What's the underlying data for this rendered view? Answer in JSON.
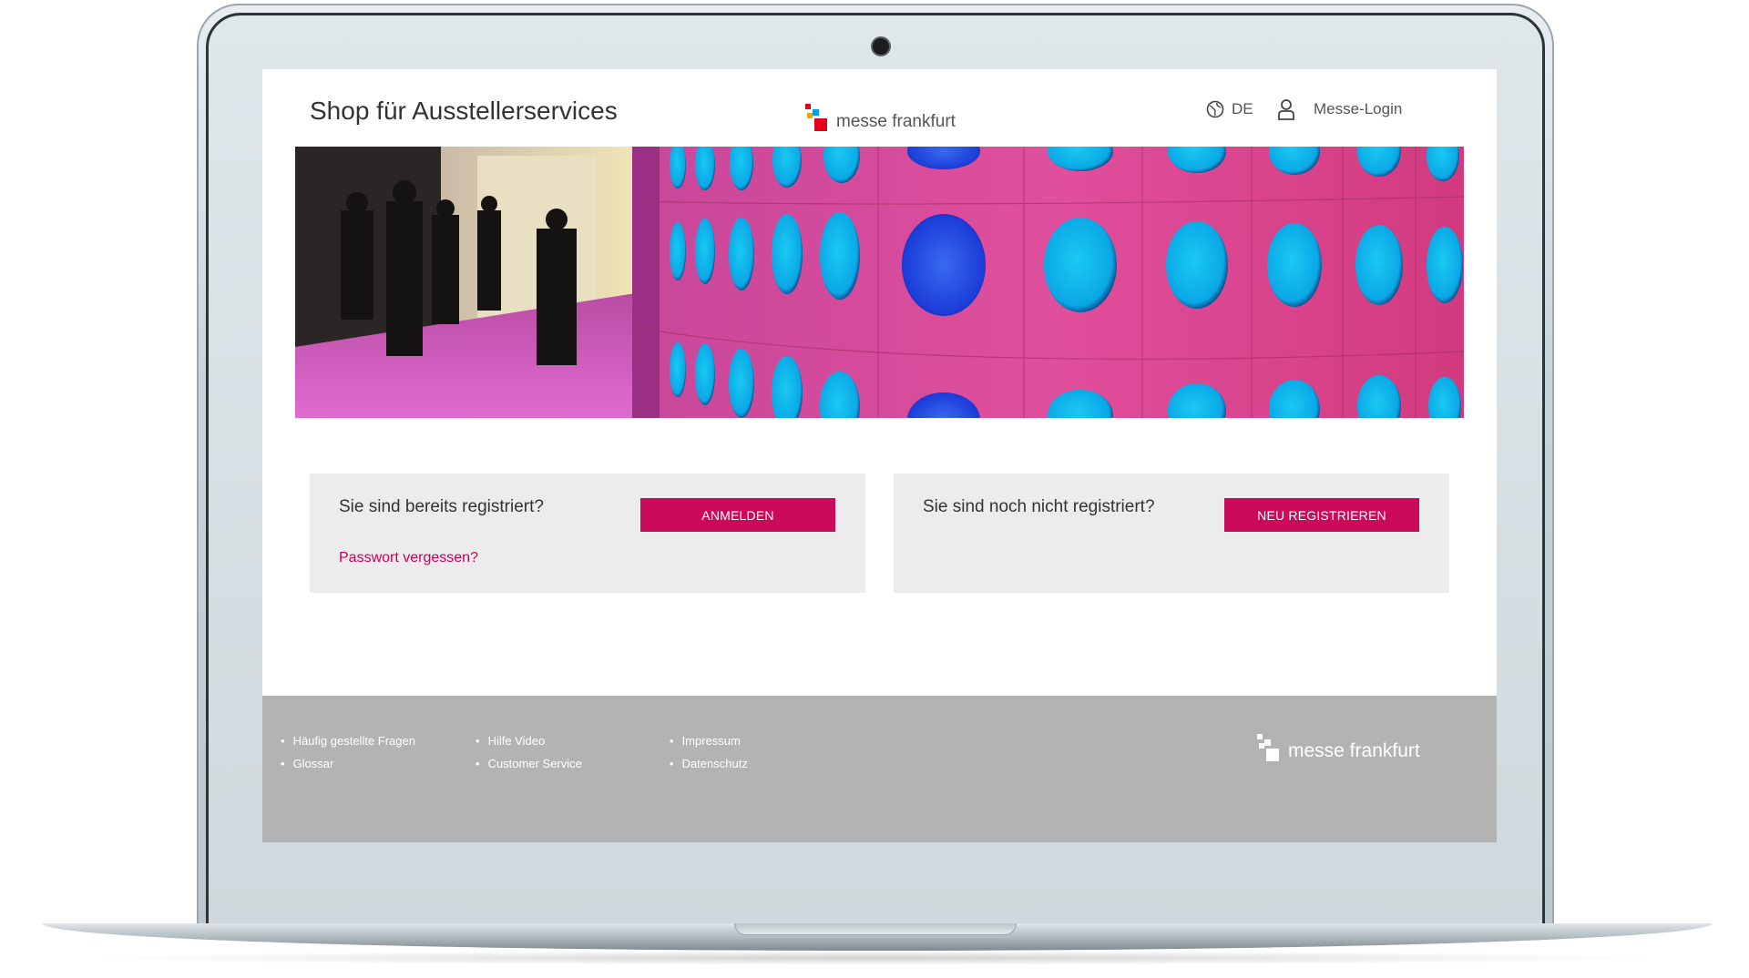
{
  "header": {
    "site_title": "Shop für Ausstellerservices",
    "brand_name": "messe frankfurt",
    "language": "DE",
    "login_label": "Messe-Login"
  },
  "login_card": {
    "question": "Sie sind bereits registriert?",
    "button_label": "ANMELDEN",
    "forgot_link": "Passwort vergessen?"
  },
  "register_card": {
    "question": "Sie sind noch nicht registriert?",
    "button_label": "NEU REGISTRIEREN"
  },
  "footer": {
    "columns": [
      {
        "items": [
          "Häufig gestellte Fragen",
          "Glossar"
        ]
      },
      {
        "items": [
          "Hilfe Video",
          "Customer Service"
        ]
      },
      {
        "items": [
          "Impressum",
          "Datenschutz"
        ]
      }
    ],
    "brand_name": "messe frankfurt"
  },
  "colors": {
    "accent": "#cc0a5a",
    "card_background": "#ececec",
    "footer_background": "#b3b3b3"
  },
  "icons": {
    "language": "globe-icon",
    "login": "user-icon"
  }
}
